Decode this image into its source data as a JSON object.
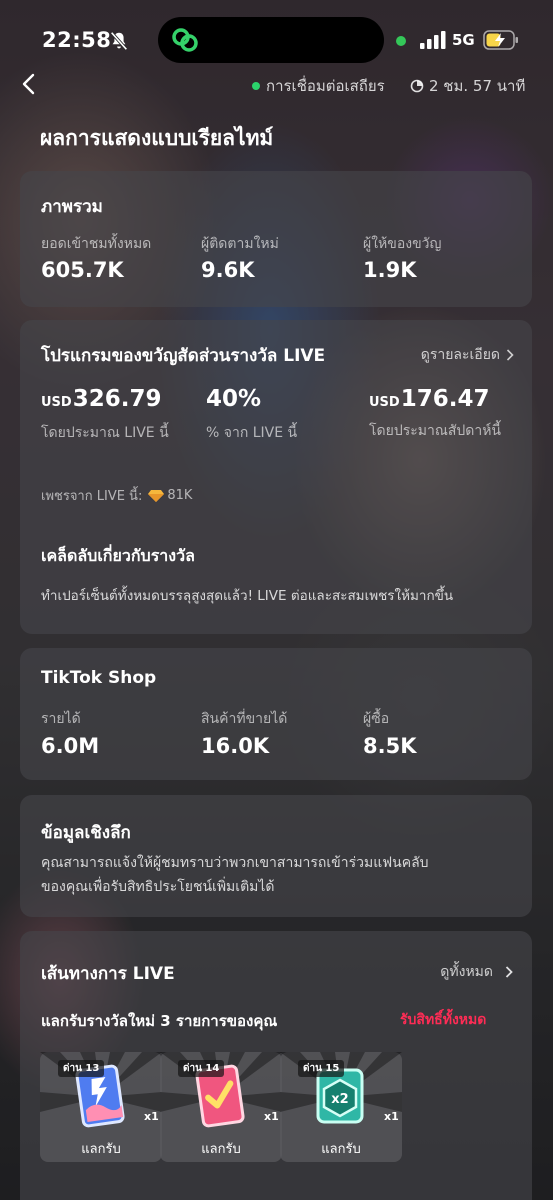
{
  "status_bar": {
    "time": "22:58",
    "network": "5G"
  },
  "header": {
    "connection_text": "การเชื่อมต่อเสถียร",
    "duration_text": "2 ชม. 57 นาที",
    "page_title": "ผลการแสดงแบบเรียลไทม์"
  },
  "overview": {
    "title": "ภาพรวม",
    "metrics": [
      {
        "label": "ยอดเข้าชมทั้งหมด",
        "value": "605.7K"
      },
      {
        "label": "ผู้ติดตามใหม่",
        "value": "9.6K"
      },
      {
        "label": "ผู้ให้ของขวัญ",
        "value": "1.9K"
      }
    ]
  },
  "gift_program": {
    "title": "โปรแกรมของขวัญสัดส่วนรางวัล LIVE",
    "detail_link": "ดูรายละเอียด",
    "currency": "USD",
    "metrics": [
      {
        "amount": "326.79",
        "label": "โดยประมาณ LIVE นี้"
      },
      {
        "amount": "40%",
        "label": "% จาก LIVE นี้"
      },
      {
        "amount": "176.47",
        "label": "โดยประมาณสัปดาห์นี้"
      }
    ],
    "diamonds_label": "เพชรจาก LIVE นี้:",
    "diamonds_value": "81K",
    "tips_title": "เคล็ดลับเกี่ยวกับรางวัล",
    "tips_text": "ทำเปอร์เซ็นต์ทั้งหมดบรรลุสูงสุดแล้ว! LIVE ต่อและสะสมเพชรให้มากขึ้น"
  },
  "shop": {
    "title": "TikTok Shop",
    "metrics": [
      {
        "label": "รายได้",
        "value": "6.0M"
      },
      {
        "label": "สินค้าที่ขายได้",
        "value": "16.0K"
      },
      {
        "label": "ผู้ซื้อ",
        "value": "8.5K"
      }
    ]
  },
  "insights": {
    "title": "ข้อมูลเชิงลึก",
    "text_line1": "คุณสามารถแจ้งให้ผู้ชมทราบว่าพวกเขาสามารถเข้าร่วมแฟนคลับ",
    "text_line2": "ของคุณเพื่อรับสิทธิประโยชน์เพิ่มเติมได้"
  },
  "live_path": {
    "title": "เส้นทางการ LIVE",
    "view_all": "ดูทั้งหมด",
    "subtitle": "แลกรับรางวัลใหม่ 3 รายการของคุณ",
    "claim_all": "รับสิทธิ์ทั้งหมด",
    "accent_color": "#fe2c55",
    "rewards": [
      {
        "level": "ด่าน 13",
        "qty": "x1",
        "action": "แลกรับ",
        "icon": "blue-card-icon"
      },
      {
        "level": "ด่าน 14",
        "qty": "x1",
        "action": "แลกรับ",
        "icon": "pink-check-card-icon"
      },
      {
        "level": "ด่าน 15",
        "qty": "x1",
        "action": "แลกรับ",
        "icon": "teal-x2-badge-icon",
        "badge_text": "x2"
      }
    ]
  }
}
